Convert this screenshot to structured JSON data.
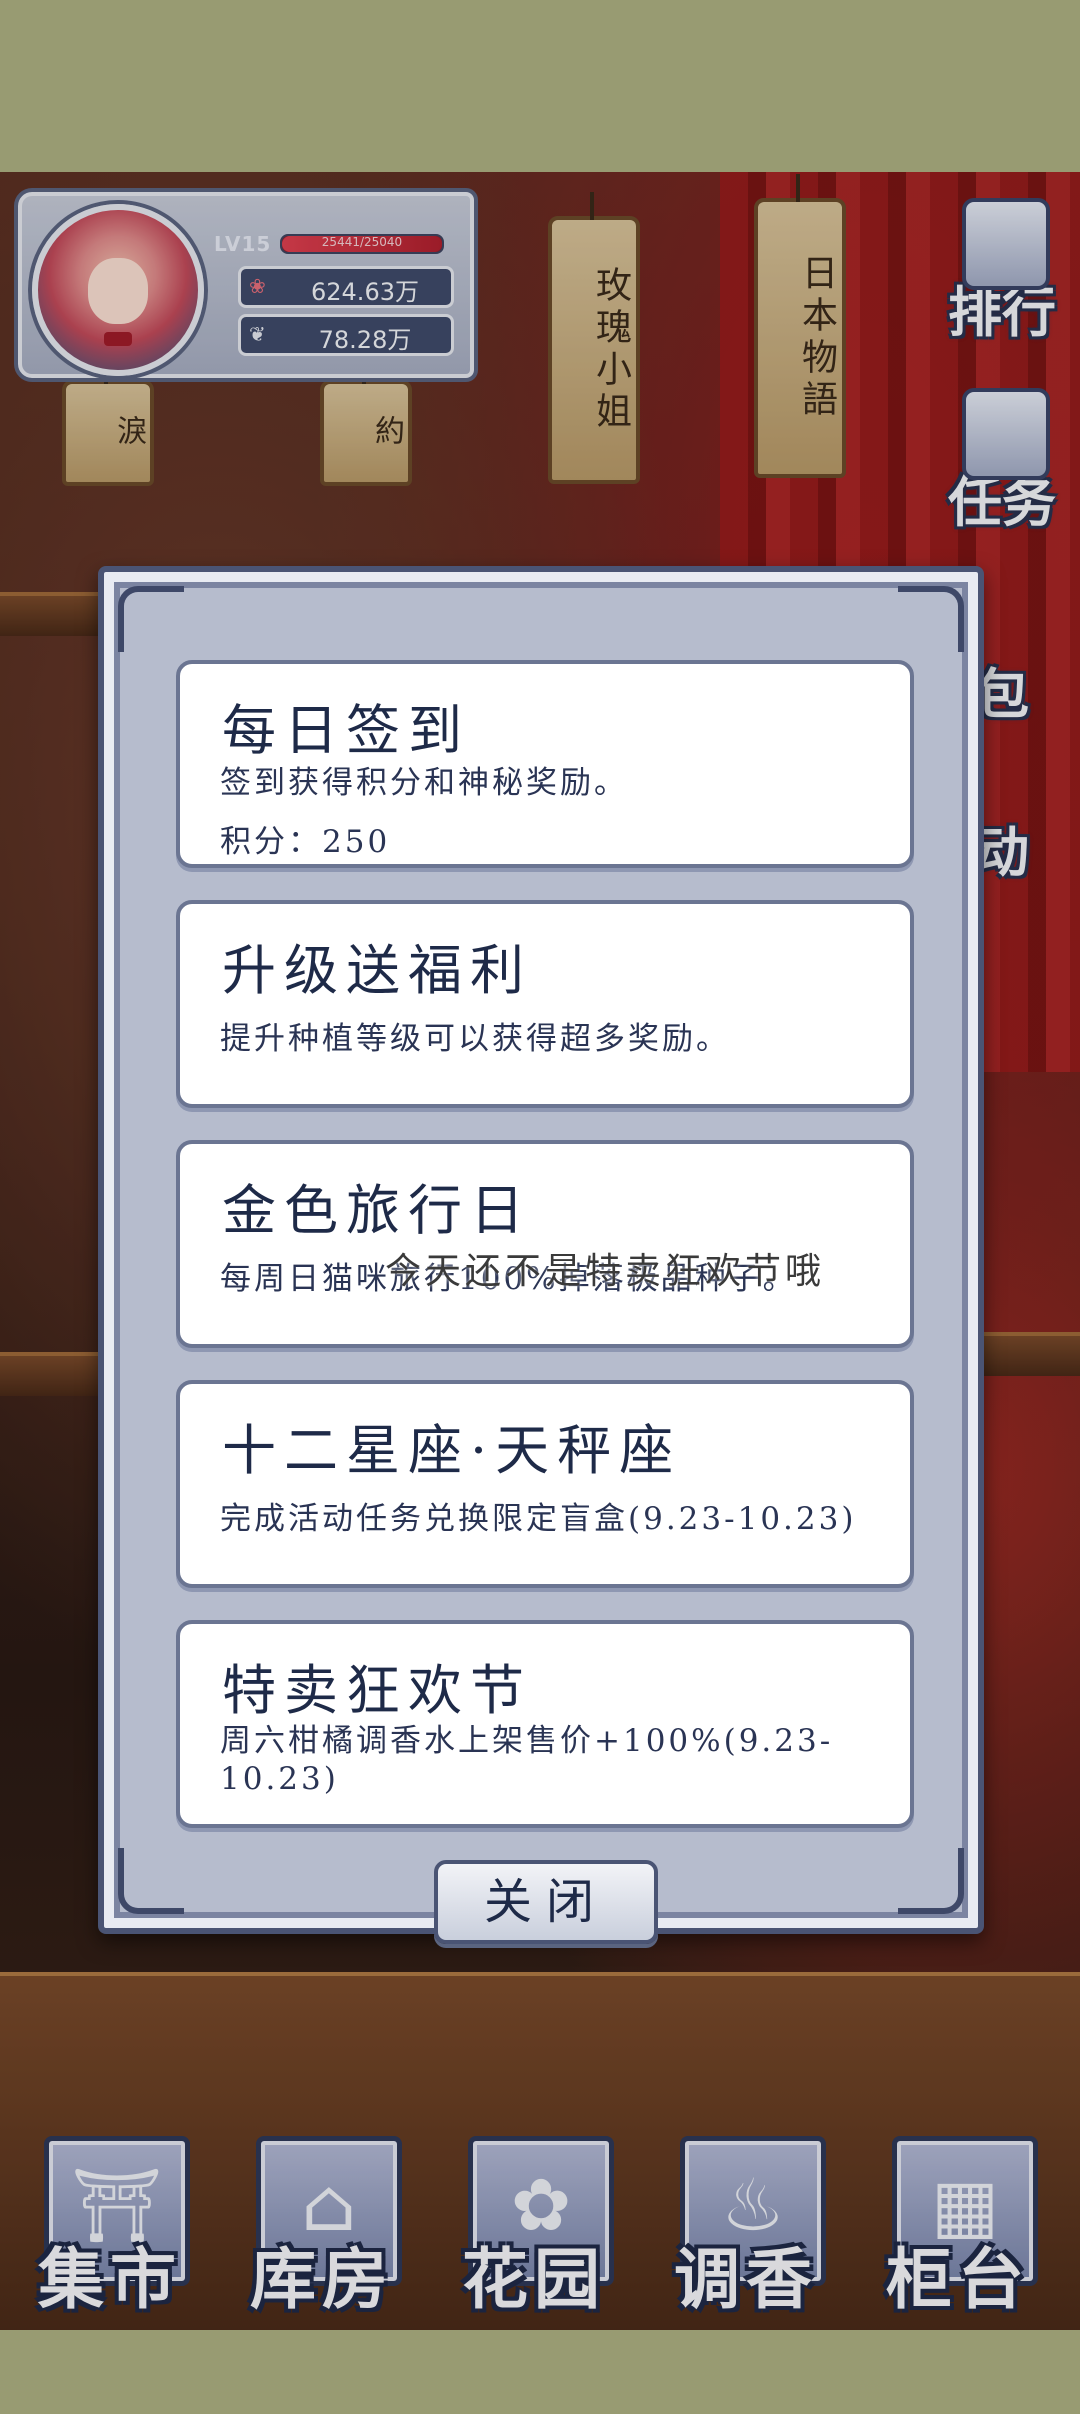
{
  "player": {
    "level": "LV15",
    "exp_text": "25441/25040",
    "exp_fraction": 1.0,
    "coins": "624.63万",
    "leaves": "78.28万"
  },
  "tags": [
    {
      "text": "玫瑰小姐"
    },
    {
      "text": "日本物語"
    },
    {
      "text": "淚"
    },
    {
      "text": "約"
    }
  ],
  "side_menu": [
    {
      "label": "排行"
    },
    {
      "label": "任务"
    },
    {
      "label": "包"
    },
    {
      "label": "动"
    }
  ],
  "dialog": {
    "cards": [
      {
        "title": "每日签到",
        "desc": "签到获得积分和神秘奖励。",
        "extra": "积分：250"
      },
      {
        "title": "升级送福利",
        "desc": "提升种植等级可以获得超多奖励。"
      },
      {
        "title": "金色旅行日",
        "desc": "每周日猫咪旅行100%掉落极品种子。"
      },
      {
        "title": "十二星座·天秤座",
        "desc": "完成活动任务兑换限定盲盒(9.23-10.23)"
      },
      {
        "title": "特卖狂欢节",
        "desc": "周六柑橘调香水上架售价+100%(9.23-10.23)"
      }
    ],
    "toast": "今天还不是特卖狂欢节哦",
    "close_label": "关闭"
  },
  "bottom_nav": [
    {
      "label": "集市",
      "icon": "gate-icon"
    },
    {
      "label": "库房",
      "icon": "house-icon"
    },
    {
      "label": "花园",
      "icon": "rose-icon"
    },
    {
      "label": "调香",
      "icon": "perfume-icon"
    },
    {
      "label": "柜台",
      "icon": "counter-icon"
    }
  ],
  "colors": {
    "frame": "#4a5474",
    "card_text": "#1e2a48",
    "backdrop": "#989b72"
  }
}
